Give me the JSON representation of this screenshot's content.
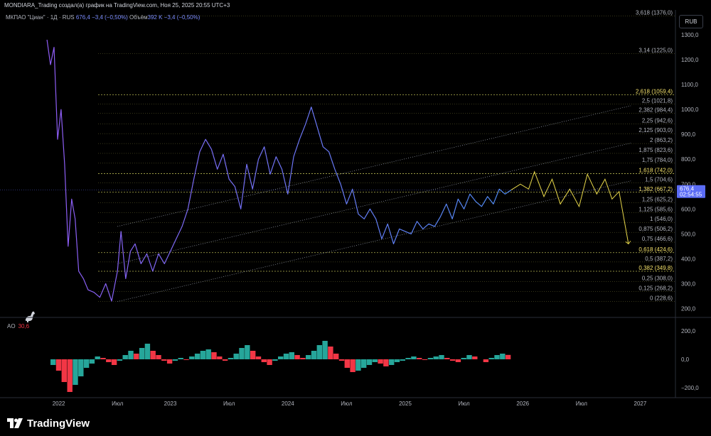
{
  "header": {
    "caption": "MONDIARA_Trading создал(а) график на TradingView.com, Ноя 25, 2025 20:55 UTC+3"
  },
  "legend": {
    "symbol": "МКПАО \"Циан\" · 1Д · RUS",
    "price": "676,4",
    "change": "−3,4 (−0,50%)",
    "volume_label": "Объём",
    "volume": "392 K",
    "volume_change": "−3,4 (−0,50%)"
  },
  "currency_button": "RUB",
  "ao_legend": {
    "name": "AO",
    "value": "30,6"
  },
  "brand": {
    "name": "TradingView"
  },
  "colors": {
    "background": "#000000",
    "fib_line": "#c8c85a",
    "price_early": "#8f5cf5",
    "price_late": "#4f8cf5",
    "forecast": "#e8d84a",
    "ao_up": "#26a69a",
    "ao_down": "#f23645",
    "last_price_bg": "#5b6cf5"
  },
  "chart_data": [
    {
      "type": "line",
      "name": "price",
      "y_unit": "RUB",
      "ylim": [
        170,
        1400
      ],
      "y_ticks": [
        {
          "value": 200,
          "label": "200,0"
        },
        {
          "value": 300,
          "label": "300,0"
        },
        {
          "value": 400,
          "label": "400,0"
        },
        {
          "value": 500,
          "label": "500,0"
        },
        {
          "value": 600,
          "label": "600,0"
        },
        {
          "value": 700,
          "label": "700,0"
        },
        {
          "value": 800,
          "label": "800,0"
        },
        {
          "value": 900,
          "label": "900,0"
        },
        {
          "value": 1000,
          "label": "1000,0"
        },
        {
          "value": 1100,
          "label": "1100,0"
        },
        {
          "value": 1200,
          "label": "1200,0"
        },
        {
          "value": 1300,
          "label": "1300,0"
        }
      ],
      "x_ticks": [
        {
          "t": 2022.05,
          "label": "2022"
        },
        {
          "t": 2022.55,
          "label": "Июл"
        },
        {
          "t": 2023.0,
          "label": "2023"
        },
        {
          "t": 2023.5,
          "label": "Июл"
        },
        {
          "t": 2024.0,
          "label": "2024"
        },
        {
          "t": 2024.5,
          "label": "Июл"
        },
        {
          "t": 2025.0,
          "label": "2025"
        },
        {
          "t": 2025.5,
          "label": "Июл"
        },
        {
          "t": 2026.0,
          "label": "2026"
        },
        {
          "t": 2026.5,
          "label": "Июл"
        },
        {
          "t": 2027.0,
          "label": "2027"
        }
      ],
      "x": [
        2021.95,
        2021.98,
        2022.01,
        2022.04,
        2022.07,
        2022.1,
        2022.13,
        2022.16,
        2022.19,
        2022.22,
        2022.26,
        2022.3,
        2022.35,
        2022.4,
        2022.45,
        2022.5,
        2022.55,
        2022.58,
        2022.62,
        2022.66,
        2022.7,
        2022.75,
        2022.8,
        2022.85,
        2022.9,
        2022.95,
        2023.0,
        2023.05,
        2023.1,
        2023.15,
        2023.2,
        2023.25,
        2023.3,
        2023.35,
        2023.4,
        2023.45,
        2023.5,
        2023.55,
        2023.6,
        2023.65,
        2023.7,
        2023.75,
        2023.8,
        2023.85,
        2023.9,
        2023.95,
        2024.0,
        2024.05,
        2024.1,
        2024.15,
        2024.2,
        2024.25,
        2024.3,
        2024.35,
        2024.4,
        2024.45,
        2024.5,
        2024.55,
        2024.6,
        2024.65,
        2024.7,
        2024.75,
        2024.8,
        2024.85,
        2024.9,
        2024.95,
        2025.0,
        2025.05,
        2025.1,
        2025.15,
        2025.2,
        2025.25,
        2025.3,
        2025.35,
        2025.4,
        2025.45,
        2025.5,
        2025.55,
        2025.6,
        2025.65,
        2025.7,
        2025.75,
        2025.8,
        2025.85,
        2025.9
      ],
      "y": [
        1280,
        1180,
        1250,
        880,
        1000,
        780,
        450,
        640,
        560,
        350,
        320,
        275,
        265,
        245,
        300,
        230,
        350,
        510,
        320,
        430,
        460,
        380,
        420,
        350,
        420,
        380,
        430,
        480,
        530,
        600,
        720,
        830,
        880,
        840,
        760,
        820,
        720,
        690,
        600,
        780,
        680,
        800,
        850,
        740,
        810,
        760,
        660,
        810,
        880,
        940,
        1010,
        930,
        850,
        830,
        760,
        700,
        620,
        680,
        580,
        560,
        600,
        560,
        480,
        540,
        460,
        520,
        510,
        500,
        550,
        520,
        540,
        530,
        570,
        620,
        560,
        640,
        600,
        660,
        630,
        610,
        650,
        620,
        680,
        660,
        676
      ]
    },
    {
      "type": "line",
      "name": "forecast",
      "x": [
        2025.9,
        2025.98,
        2026.05,
        2026.1,
        2026.18,
        2026.25,
        2026.32,
        2026.4,
        2026.48,
        2026.55,
        2026.63,
        2026.7,
        2026.76,
        2026.82,
        2026.9
      ],
      "y": [
        676,
        700,
        680,
        750,
        650,
        720,
        620,
        680,
        610,
        740,
        660,
        720,
        640,
        670,
        460
      ]
    },
    {
      "type": "fibonacci",
      "levels": [
        {
          "ratio": "0",
          "price": 228.6,
          "label": "0 (228,6)",
          "highlight": false
        },
        {
          "ratio": "0,125",
          "price": 268.2,
          "label": "0,125 (268,2)",
          "highlight": false
        },
        {
          "ratio": "0,25",
          "price": 308.0,
          "label": "0,25 (308,0)",
          "highlight": false
        },
        {
          "ratio": "0,382",
          "price": 349.8,
          "label": "0,382 (349,8)",
          "highlight": true
        },
        {
          "ratio": "0,5",
          "price": 387.2,
          "label": "0,5 (387,2)",
          "highlight": false
        },
        {
          "ratio": "0,618",
          "price": 424.6,
          "label": "0,618 (424,6)",
          "highlight": true
        },
        {
          "ratio": "0,75",
          "price": 466.6,
          "label": "0,75 (466,6)",
          "highlight": false
        },
        {
          "ratio": "0,875",
          "price": 506.2,
          "label": "0,875 (506,2)",
          "highlight": false
        },
        {
          "ratio": "1",
          "price": 546.0,
          "label": "1 (546,0)",
          "highlight": false
        },
        {
          "ratio": "1,125",
          "price": 585.6,
          "label": "1,125 (585,6)",
          "highlight": false
        },
        {
          "ratio": "1,25",
          "price": 625.2,
          "label": "1,25 (625,2)",
          "highlight": false
        },
        {
          "ratio": "1,382",
          "price": 667.2,
          "label": "1,382 (667,2)",
          "highlight": true
        },
        {
          "ratio": "1,5",
          "price": 704.6,
          "label": "1,5 (704,6)",
          "highlight": false
        },
        {
          "ratio": "1,618",
          "price": 742.0,
          "label": "1,618 (742,0)",
          "highlight": true
        },
        {
          "ratio": "1,75",
          "price": 784.0,
          "label": "1,75 (784,0)",
          "highlight": false
        },
        {
          "ratio": "1,875",
          "price": 823.6,
          "label": "1,875 (823,6)",
          "highlight": false
        },
        {
          "ratio": "2",
          "price": 863.2,
          "label": "2 (863,2)",
          "highlight": false
        },
        {
          "ratio": "2,125",
          "price": 903.0,
          "label": "2,125 (903,0)",
          "highlight": false
        },
        {
          "ratio": "2,25",
          "price": 942.6,
          "label": "2,25 (942,6)",
          "highlight": false
        },
        {
          "ratio": "2,382",
          "price": 984.4,
          "label": "2,382 (984,4)",
          "highlight": false
        },
        {
          "ratio": "2,5",
          "price": 1021.8,
          "label": "2,5 (1021,8)",
          "highlight": false
        },
        {
          "ratio": "2,618",
          "price": 1059.4,
          "label": "2,618 (1059,4)",
          "highlight": true
        },
        {
          "ratio": "3,14",
          "price": 1225.0,
          "label": "3,14 (1225,0)",
          "highlight": false
        },
        {
          "ratio": "3,618",
          "price": 1376.0,
          "label": "3,618 (1376,0)",
          "highlight": false
        }
      ]
    },
    {
      "type": "line",
      "name": "channel",
      "lines": [
        {
          "x": [
            2022.55,
            2026.92
          ],
          "y": [
            530,
            1015
          ]
        },
        {
          "x": [
            2022.55,
            2026.92
          ],
          "y": [
            380,
            865
          ]
        },
        {
          "x": [
            2022.55,
            2026.92
          ],
          "y": [
            228,
            713
          ]
        }
      ]
    },
    {
      "type": "bar",
      "name": "AO",
      "ylim": [
        -270,
        280
      ],
      "y_ticks": [
        {
          "value": 200,
          "label": "200,0"
        },
        {
          "value": 0,
          "label": "0,0"
        },
        {
          "value": -200,
          "label": "−200,0"
        }
      ],
      "x_start": 2021.98,
      "x_end": 2025.9,
      "values": [
        -40,
        -80,
        -160,
        -230,
        -180,
        -120,
        -60,
        -30,
        20,
        10,
        -20,
        -40,
        -10,
        30,
        60,
        40,
        80,
        110,
        60,
        30,
        -10,
        -30,
        -10,
        10,
        -5,
        20,
        40,
        60,
        70,
        50,
        20,
        -10,
        10,
        40,
        80,
        100,
        60,
        20,
        -20,
        -40,
        -10,
        20,
        40,
        50,
        30,
        10,
        30,
        60,
        100,
        130,
        90,
        40,
        -10,
        -60,
        -90,
        -80,
        -60,
        -40,
        -20,
        -30,
        -50,
        -40,
        -20,
        -10,
        10,
        20,
        10,
        -5,
        10,
        20,
        30,
        10,
        -10,
        -20,
        10,
        30,
        20,
        0,
        -20,
        10,
        30,
        40,
        31
      ]
    }
  ],
  "last_price_label": {
    "price": "676,4",
    "time": "02:54:55"
  }
}
